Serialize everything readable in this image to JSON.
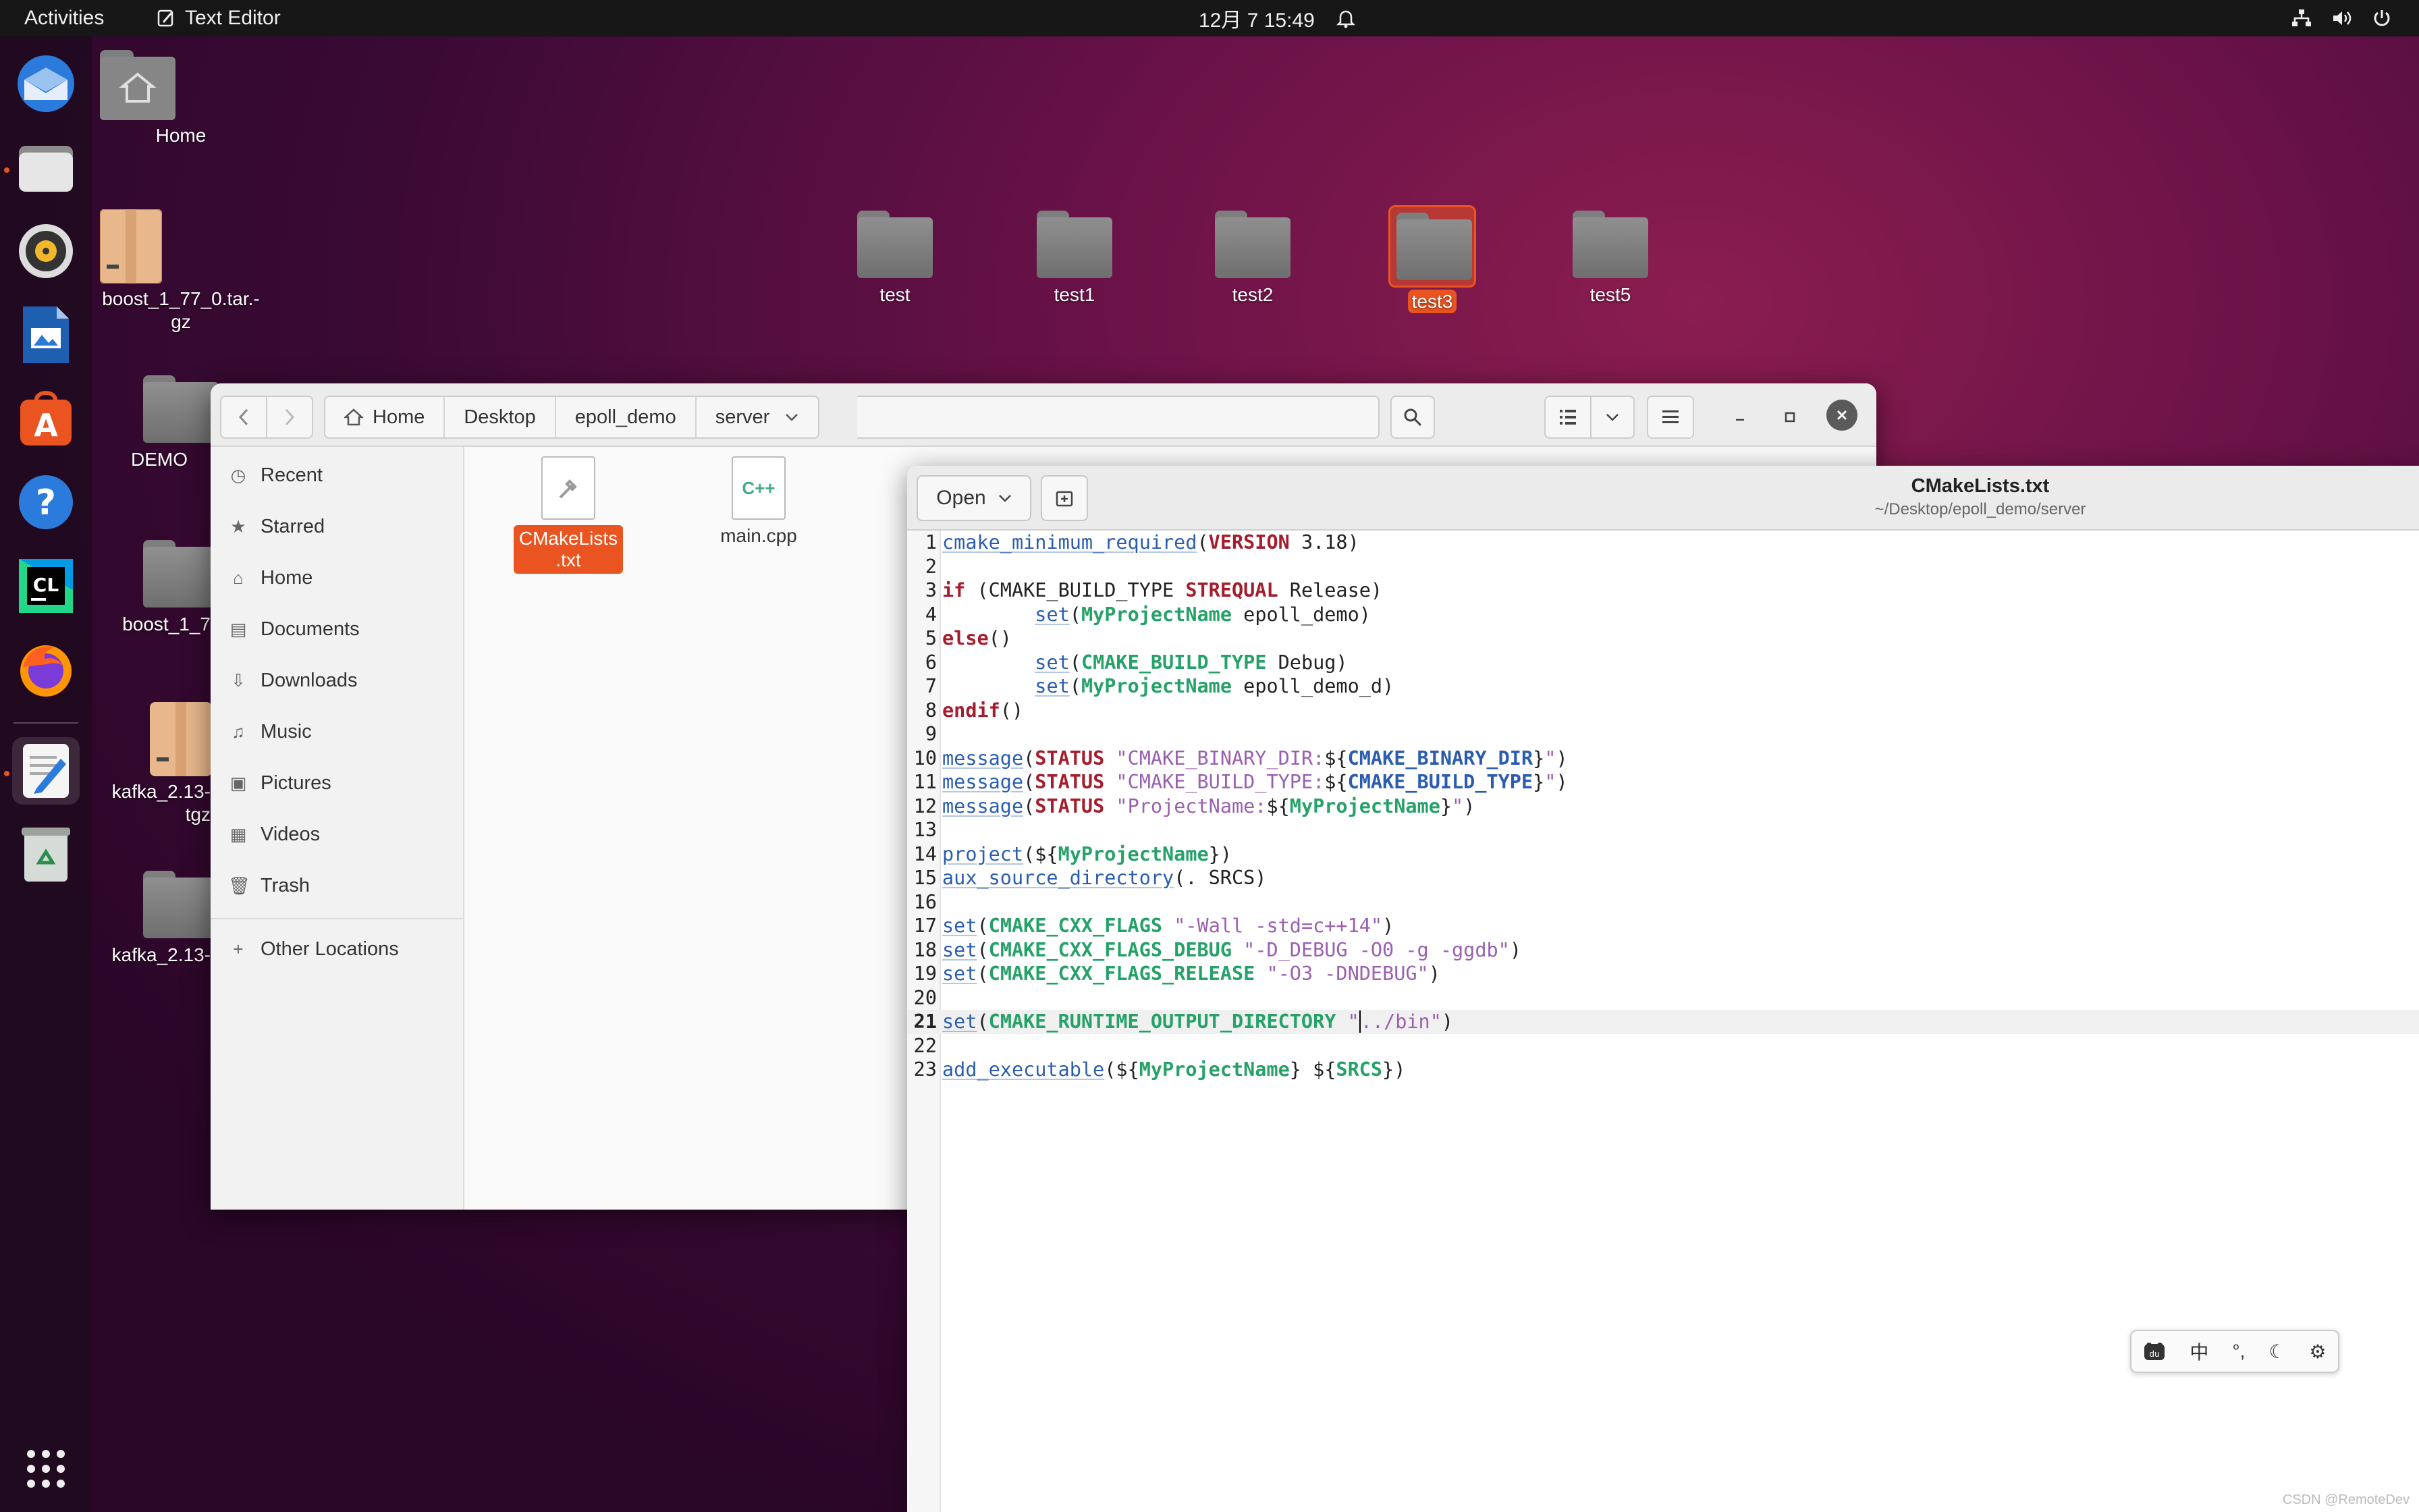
{
  "topbar": {
    "activities": "Activities",
    "app_name": "Text Editor",
    "clock": "12月 7  15:49"
  },
  "dock": {
    "apps": [
      "thunderbird-icon",
      "files-icon",
      "rhythmbox-icon",
      "writer-icon",
      "software-icon",
      "help-icon",
      "clion-icon",
      "firefox-icon",
      "text-editor-icon",
      "trash-icon"
    ],
    "show_apps": "show-apps-icon"
  },
  "desktop": {
    "home": "Home",
    "boost_archive": "boost_1_77_0.tar.-\ngz",
    "demo": "DEMO",
    "boost_folder": "boost_1_7",
    "kafka_archive": "kafka_2.13-\ntgz",
    "kafka_folder": "kafka_2.13-",
    "folders": [
      "test",
      "test1",
      "test2",
      "test3",
      "test5"
    ]
  },
  "files": {
    "crumbs": [
      "Home",
      "Desktop",
      "epoll_demo",
      "server"
    ],
    "sidebar": [
      "Recent",
      "Starred",
      "Home",
      "Documents",
      "Downloads",
      "Music",
      "Pictures",
      "Videos",
      "Trash"
    ],
    "other_locations": "Other Locations",
    "items": [
      {
        "label": "CMakeLists\n.txt",
        "selected": true
      },
      {
        "label": "main.cpp",
        "selected": false
      }
    ],
    "cpp_badge": "C++"
  },
  "editor": {
    "open_label": "Open",
    "title": "CMakeLists.txt",
    "path": "~/Desktop/epoll_demo/server",
    "current_line": 21
  },
  "ime": {
    "mode": "中",
    "punct": "°,"
  },
  "watermark": "CSDN @RemoteDev"
}
